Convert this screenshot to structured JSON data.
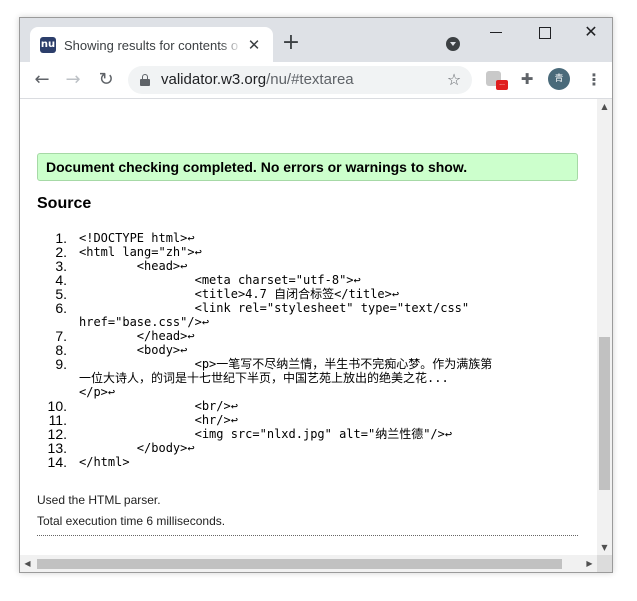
{
  "browser": {
    "tab": {
      "favicon_text": "nu",
      "title": "Showing results for contents of text-input area"
    },
    "toolbar": {
      "url_host": "validator.w3.org",
      "url_path": "/nu/#textarea",
      "ext_badge": "...",
      "avatar_text": "青"
    },
    "icons": {
      "back": "back-arrow-icon",
      "forward": "forward-arrow-icon",
      "reload": "reload-icon",
      "lock": "lock-icon",
      "star": "bookmark-star-icon",
      "puzzle": "extensions-puzzle-icon",
      "menu": "kebab-menu-icon"
    }
  },
  "page": {
    "status_message": "Document checking completed. No errors or warnings to show.",
    "source_heading": "Source",
    "source_lines": [
      {
        "num": "1.",
        "text": "<!DOCTYPE html>↩"
      },
      {
        "num": "2.",
        "text": "<html lang=\"zh\">↩"
      },
      {
        "num": "3.",
        "text": "        <head>↩"
      },
      {
        "num": "4.",
        "text": "                <meta charset=\"utf-8\">↩"
      },
      {
        "num": "5.",
        "text": "                <title>4.7 自闭合标签</title>↩"
      },
      {
        "num": "6.",
        "text": "                <link rel=\"stylesheet\" type=\"text/css\"",
        "wrap": "href=\"base.css\"/>↩"
      },
      {
        "num": "7.",
        "text": "        </head>↩"
      },
      {
        "num": "8.",
        "text": "        <body>↩"
      },
      {
        "num": "9.",
        "text": "                <p>一笔写不尽纳兰情，半生书不完痴心梦。作为满族第",
        "wrap": "一位大诗人，的词是十七世纪下半页，中国艺苑上放出的绝美之花...",
        "wrap2": "</p>↩"
      },
      {
        "num": "10.",
        "text": "                <br/>↩"
      },
      {
        "num": "11.",
        "text": "                <hr/>↩"
      },
      {
        "num": "12.",
        "text": "                <img src=\"nlxd.jpg\" alt=\"纳兰性德\"/>↩"
      },
      {
        "num": "13.",
        "text": "        </body>↩"
      },
      {
        "num": "14.",
        "text": "</html>"
      }
    ],
    "parser_note": "Used the HTML parser.",
    "time_note": "Total execution time 6 milliseconds."
  },
  "colors": {
    "success_bg": "#ccffcc",
    "tabstrip_bg": "#dee1e6"
  }
}
